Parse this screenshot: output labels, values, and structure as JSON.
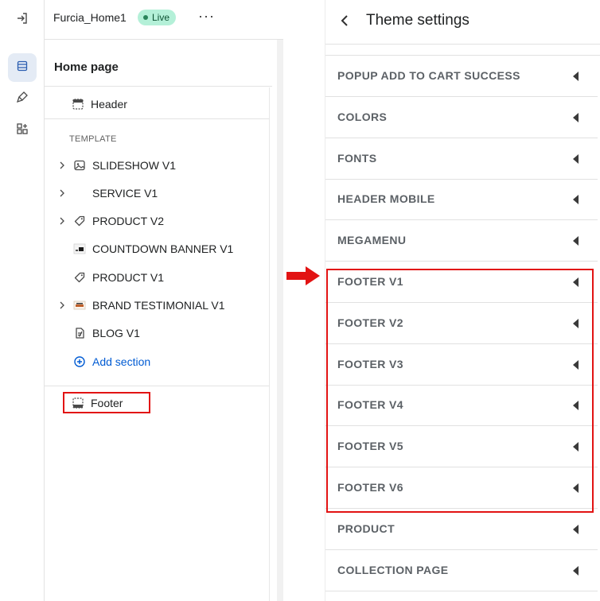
{
  "editor": {
    "theme_name": "Furcia_Home1",
    "status_badge": "Live",
    "more_label": "···",
    "page_title": "Home page",
    "header_item": "Header",
    "template_heading": "TEMPLATE",
    "sections": [
      {
        "label": "SLIDESHOW V1",
        "has_chevron": true,
        "icon": "image-icon"
      },
      {
        "label": "SERVICE V1",
        "has_chevron": true,
        "icon": ""
      },
      {
        "label": "PRODUCT V2",
        "has_chevron": true,
        "icon": "tag-icon"
      },
      {
        "label": "COUNTDOWN BANNER V1",
        "has_chevron": false,
        "icon": "banner-thumb-icon"
      },
      {
        "label": "PRODUCT V1",
        "has_chevron": false,
        "icon": "tag-icon"
      },
      {
        "label": "BRAND TESTIMONIAL V1",
        "has_chevron": true,
        "icon": "testimonial-thumb-icon"
      },
      {
        "label": "BLOG V1",
        "has_chevron": false,
        "icon": "document-icon"
      }
    ],
    "add_section": "Add section",
    "footer_item": "Footer"
  },
  "theme_settings": {
    "title": "Theme settings",
    "items": [
      "POPUP ADD TO CART SUCCESS",
      "COLORS",
      "FONTS",
      "HEADER MOBILE",
      "MEGAMENU",
      "FOOTER V1",
      "FOOTER V2",
      "FOOTER V3",
      "FOOTER V4",
      "FOOTER V5",
      "FOOTER V6",
      "PRODUCT",
      "COLLECTION PAGE"
    ]
  },
  "colors": {
    "highlight": "#e21313",
    "accent_link": "#005bd3",
    "live_badge_bg": "#b4f0d8",
    "active_rail_bg": "#e4ebf5"
  }
}
